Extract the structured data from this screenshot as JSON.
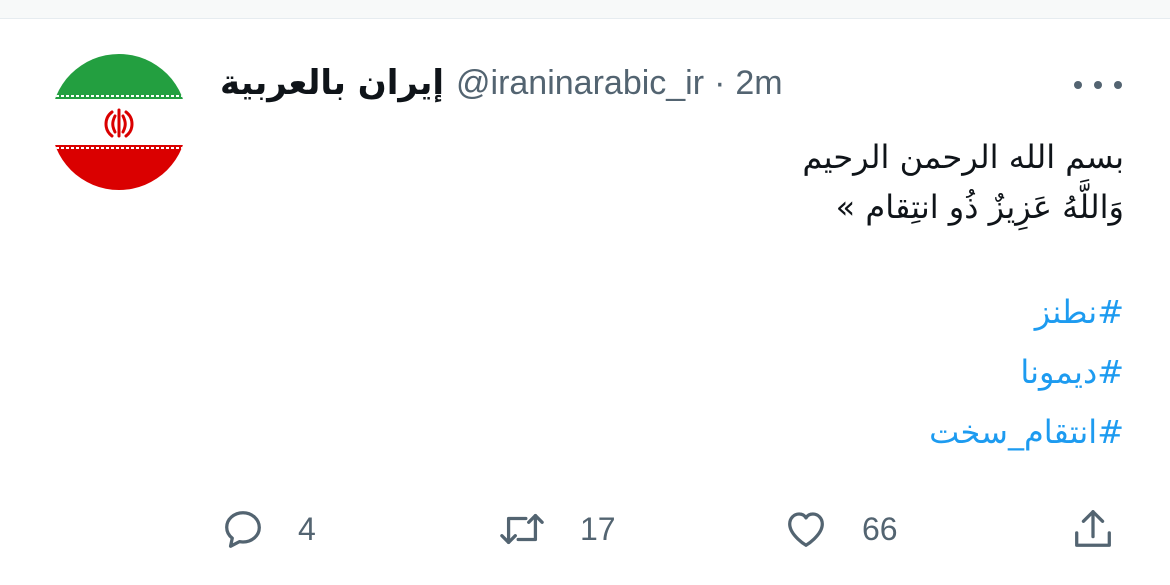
{
  "tweet": {
    "display_name": "إيران بالعربية",
    "handle": "@iraninarabic_ir",
    "separator": "·",
    "time": "2m",
    "lines": [
      "بسم الله الرحمن الرحيم",
      "وَاللَّهُ عَزِيزٌ ذُو انتِقام »"
    ],
    "hashtags": [
      "#نطنز",
      "#ديمونا",
      "#انتقام_سخت"
    ]
  },
  "actions": {
    "reply_count": "4",
    "retweet_count": "17",
    "like_count": "66"
  },
  "icons": {
    "avatar": "iran-flag",
    "more": "more-horizontal-icon",
    "reply": "reply-icon",
    "retweet": "retweet-icon",
    "like": "heart-icon",
    "share": "share-icon"
  },
  "colors": {
    "link": "#1d9bf0",
    "muted": "#536471",
    "flag_green": "#239f40",
    "flag_red": "#da0000"
  }
}
